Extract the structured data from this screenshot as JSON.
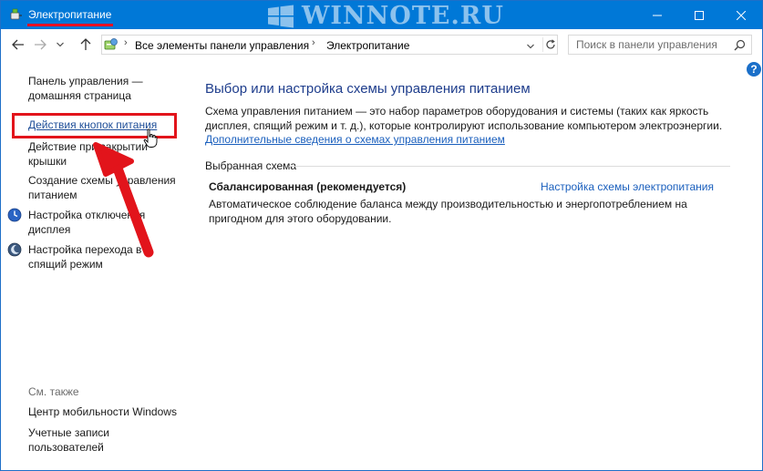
{
  "window": {
    "title": "Электропитание",
    "watermark": "WINNOTE.RU"
  },
  "addressbar": {
    "breadcrumbs": [
      "Все элементы панели управления",
      "Электропитание"
    ],
    "search_placeholder": "Поиск в панели управления"
  },
  "sidebar": {
    "home": "Панель управления — домашняя страница",
    "items": [
      {
        "label": "Действия кнопок питания"
      },
      {
        "label": "Действие при закрытии крышки"
      },
      {
        "label": "Создание схемы управления питанием"
      },
      {
        "label": "Настройка отключения дисплея"
      },
      {
        "label": "Настройка перехода в спящий режим"
      }
    ],
    "see_also_label": "См. также",
    "see_also": [
      {
        "label": "Центр мобильности Windows"
      },
      {
        "label": "Учетные записи пользователей"
      }
    ]
  },
  "main": {
    "title": "Выбор или настройка схемы управления питанием",
    "description": "Схема управления питанием — это набор параметров оборудования и системы (таких как яркость дисплея, спящий режим и т. д.), которые контролируют использование компьютером электроэнергии.",
    "more_link": "Дополнительные сведения о схемах управления питанием",
    "group_label": "Выбранная схема",
    "plan": {
      "name": "Сбалансированная (рекомендуется)",
      "settings_link": "Настройка схемы электропитания",
      "description": "Автоматическое соблюдение баланса между производительностью и энергопотреблением на пригодном для этого оборудовании."
    }
  },
  "colors": {
    "titlebar": "#0078d7",
    "accent_red": "#e2141b",
    "link": "#1a5fbd"
  }
}
